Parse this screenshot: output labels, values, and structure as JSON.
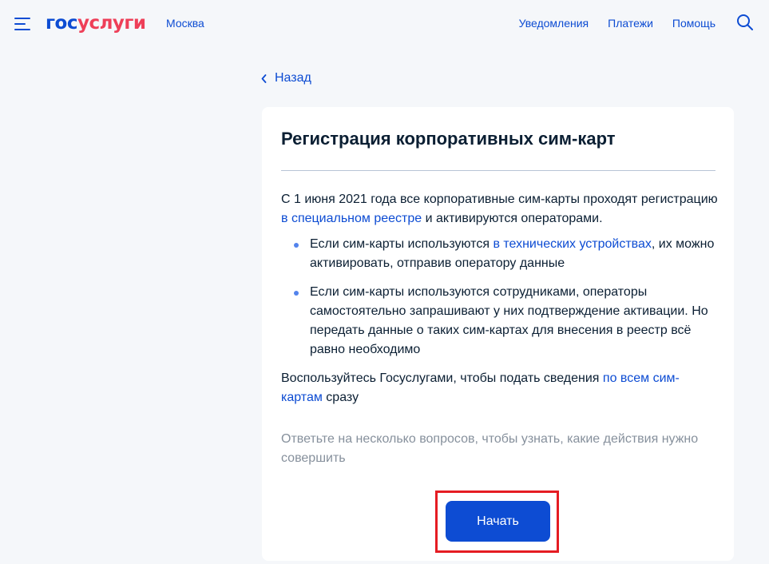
{
  "header": {
    "logo_part1": "гос",
    "logo_part2": "услуги",
    "city": "Москва",
    "nav": [
      {
        "label": "Уведомления"
      },
      {
        "label": "Платежи"
      },
      {
        "label": "Помощь"
      }
    ],
    "icons": {
      "menu": "burger-menu-icon",
      "search": "search-icon"
    }
  },
  "back_label": "Назад",
  "card": {
    "title": "Регистрация корпоративных сим-карт",
    "intro_text_1": "С 1 июня 2021 года все корпоративные сим-карты проходят регистрацию ",
    "intro_link": "в специальном реестре",
    "intro_text_2": " и активируются операторами.",
    "bullets": [
      {
        "text_1": "Если сим-карты используются ",
        "link": "в технических устройствах",
        "text_2": ", их можно активировать, отправив оператору данные"
      },
      {
        "text_1": "Если сим-карты используются сотрудниками, операторы самостоятельно запрашивают у них подтверждение активации. Но передать данные о таких сим-картах для внесения в реестр всё равно необходимо",
        "link": "",
        "text_2": ""
      }
    ],
    "outro_text_1": "Воспользуйтесь Госуслугами, чтобы подать сведения ",
    "outro_link": "по всем сим-картам",
    "outro_text_2": " сразу",
    "hint": "Ответьте на несколько вопросов, чтобы узнать, какие действия нужно совершить",
    "start_button": "Начать"
  },
  "colors": {
    "brand_blue": "#0d4cd3",
    "brand_red": "#ee3f58",
    "highlight": "#e51c23",
    "background": "#f5f7fa"
  }
}
